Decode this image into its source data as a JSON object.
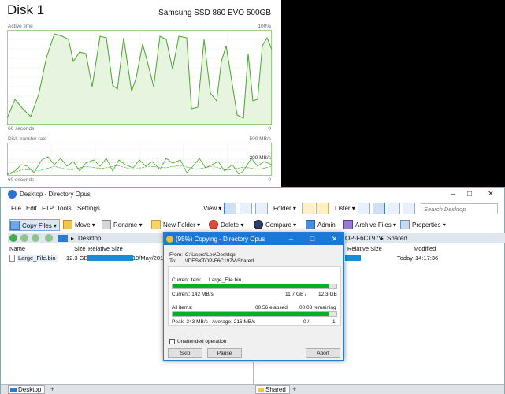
{
  "task_manager": {
    "title": "Disk 1",
    "model": "Samsung SSD 860 EVO 500GB",
    "active_time_label": "Active time",
    "active_time_max": "100%",
    "active_seconds": "60 seconds",
    "active_min": "0",
    "transfer_label": "Disk transfer rate",
    "transfer_max": "500 MB/s",
    "transfer_mid": "200 MB/s",
    "transfer_seconds": "60 seconds",
    "transfer_min": "0",
    "accent_color": "#4aa52e"
  },
  "dopus": {
    "window_title": "Desktop - Directory Opus",
    "menu": [
      "File",
      "Edit",
      "FTP",
      "Tools",
      "Settings"
    ],
    "view_label": "View",
    "folder_label": "Folder",
    "lister_label": "Lister",
    "search_placeholder": "Search Desktop",
    "toolbar": {
      "copy": "Copy Files",
      "move": "Move",
      "rename": "Rename",
      "new_folder": "New Folder",
      "delete": "Delete",
      "compare": "Compare",
      "admin": "Admin",
      "archive": "Archive Files",
      "properties": "Properties"
    },
    "left_path": "Desktop",
    "right_path_partial": "OP-F6C197V",
    "right_path_last": "Shared",
    "columns_left": {
      "name": "Name",
      "size": "Size",
      "relsize": "Relative Size"
    },
    "columns_right": {
      "relsize": "Relative Size",
      "modified": "Modified"
    },
    "left_row": {
      "name": "Large_File.bin",
      "size": "12.3 GB",
      "date": "19/May/2019"
    },
    "right_row": {
      "modified_day": "Today",
      "modified_time": "14:17:36"
    },
    "tab_left": "Desktop",
    "tab_right": "Shared"
  },
  "dialog": {
    "title": "(95%) Copying - Directory Opus",
    "from_label": "From:",
    "from_value": "C:\\Users\\Leo\\Desktop",
    "to_label": "To:",
    "to_value": "\\\\DESKTOP-F6C197V\\Shared",
    "current_item_label": "Current item:",
    "current_item_value": "Large_File.bin",
    "current_progress": 0.95,
    "current_rate": "Current: 142 MB/s",
    "current_done": "11.7 GB /",
    "current_total": "12.3 GB",
    "all_items_label": "All items:",
    "elapsed": "00:56 elapsed",
    "remaining": "00:03 remaining",
    "all_progress": 0.95,
    "peak": "Peak: 343 MB/s",
    "average": "Average: 216 MB/s",
    "items_done": "0 /",
    "items_total": "1",
    "unattended": "Unattended operation",
    "skip": "Skip",
    "pause": "Pause",
    "abort": "Abort"
  }
}
